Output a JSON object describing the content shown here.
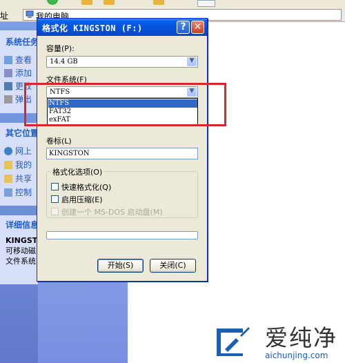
{
  "explorer": {
    "address_label": "址",
    "address_value": "我的电脑",
    "system_tasks": {
      "title": "系统任务",
      "items": [
        "查看",
        "添加",
        "更改",
        "弹出"
      ]
    },
    "other_places": {
      "title": "其它位置",
      "items": [
        "网上",
        "我的",
        "共享",
        "控制"
      ]
    },
    "details": {
      "title": "详细信息",
      "lines": [
        "KINGSTON",
        "可移动磁",
        "文件系统"
      ]
    },
    "background_text": ":)"
  },
  "dialog": {
    "title": "格式化 KINGSTON (F:)",
    "help_label": "?",
    "close_label": "✕",
    "capacity_label": "容量(P):",
    "capacity_value": "14.4 GB",
    "filesystem_label": "文件系统(F)",
    "filesystem_value": "NTFS",
    "filesystem_options": [
      "NTFS",
      "FAT32",
      "exFAT"
    ],
    "filesystem_selected_index": 0,
    "volume_label": "卷标(L)",
    "volume_value": "KINGSTON",
    "format_options_label": "格式化选项(O)",
    "options": [
      {
        "label": "快速格式化(Q)",
        "checked": false,
        "disabled": false
      },
      {
        "label": "启用压缩(E)",
        "checked": false,
        "disabled": false
      },
      {
        "label": "创建一个 MS-DOS 启动盘(M)",
        "checked": false,
        "disabled": true
      }
    ],
    "progress": 0,
    "start_button": "开始(S)",
    "close_button": "关闭(C)"
  },
  "watermark": {
    "brand_cn": "爱纯净",
    "url": "aichunjing.com"
  },
  "colors": {
    "titlebar": "#0552db",
    "highlight": "#d9262c",
    "selection": "#316ac5"
  }
}
